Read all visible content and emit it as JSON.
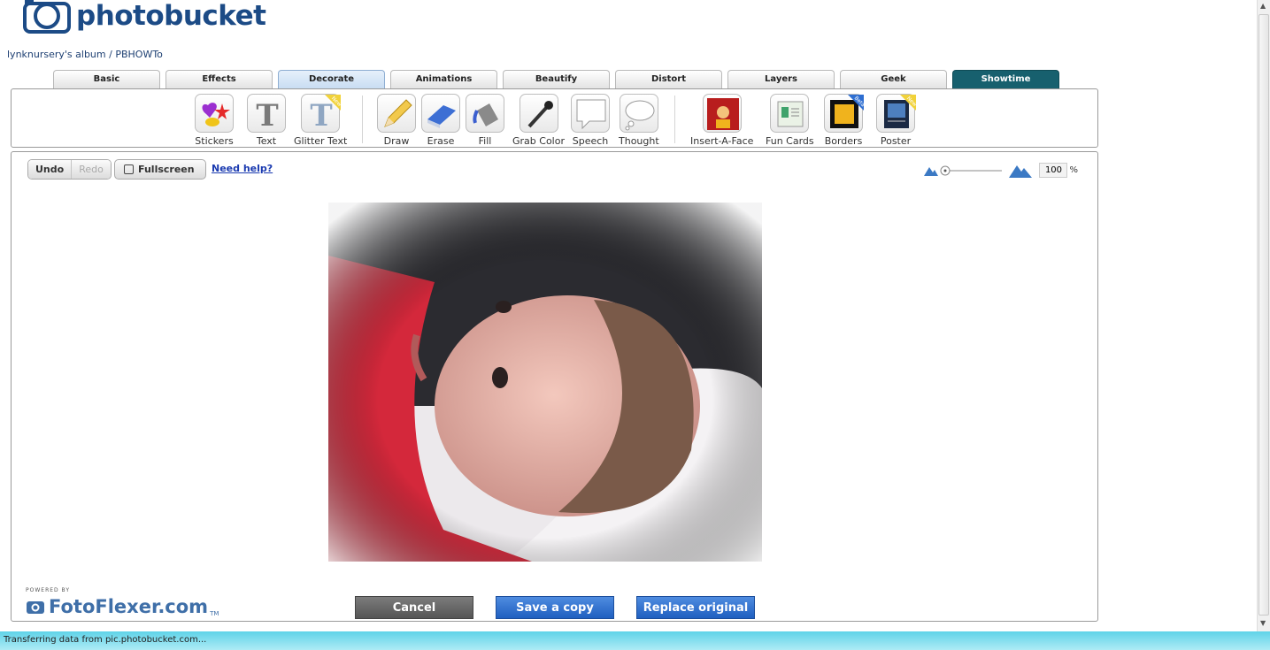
{
  "brand": {
    "logo_text": "photobucket"
  },
  "breadcrumb": {
    "album": "lynknursery's album",
    "separator": "/",
    "folder": "PBHOWTo"
  },
  "tabs": [
    {
      "label": "Basic"
    },
    {
      "label": "Effects"
    },
    {
      "label": "Decorate"
    },
    {
      "label": "Animations"
    },
    {
      "label": "Beautify"
    },
    {
      "label": "Distort"
    },
    {
      "label": "Layers"
    },
    {
      "label": "Geek"
    },
    {
      "label": "Showtime"
    }
  ],
  "active_tab": "Decorate",
  "tools": {
    "stickers": "Stickers",
    "text": "Text",
    "glitter_text": "Glitter Text",
    "draw": "Draw",
    "erase": "Erase",
    "fill": "Fill",
    "grab_color": "Grab Color",
    "speech": "Speech",
    "thought": "Thought",
    "insert_a_face": "Insert-A-Face",
    "fun_cards": "Fun Cards",
    "borders": "Borders",
    "poster": "Poster",
    "badge_new": "New",
    "badge_beta": "Beta"
  },
  "controls": {
    "undo": "Undo",
    "redo": "Redo",
    "fullscreen": "Fullscreen",
    "help": "Need help?",
    "zoom_value": "100",
    "zoom_unit": "%"
  },
  "footer": {
    "powered_by": "POWERED BY",
    "brand": "FotoFlexer.com",
    "tm": "TM",
    "cancel": "Cancel",
    "save_copy": "Save a copy",
    "replace": "Replace original"
  },
  "status": {
    "message": "Transferring data from pic.photobucket.com..."
  },
  "colors": {
    "showtime_tab": "#17606e",
    "primary_button": "#1f5fc0",
    "cancel_button": "#555555",
    "status_bar": "#5fd3e8"
  }
}
